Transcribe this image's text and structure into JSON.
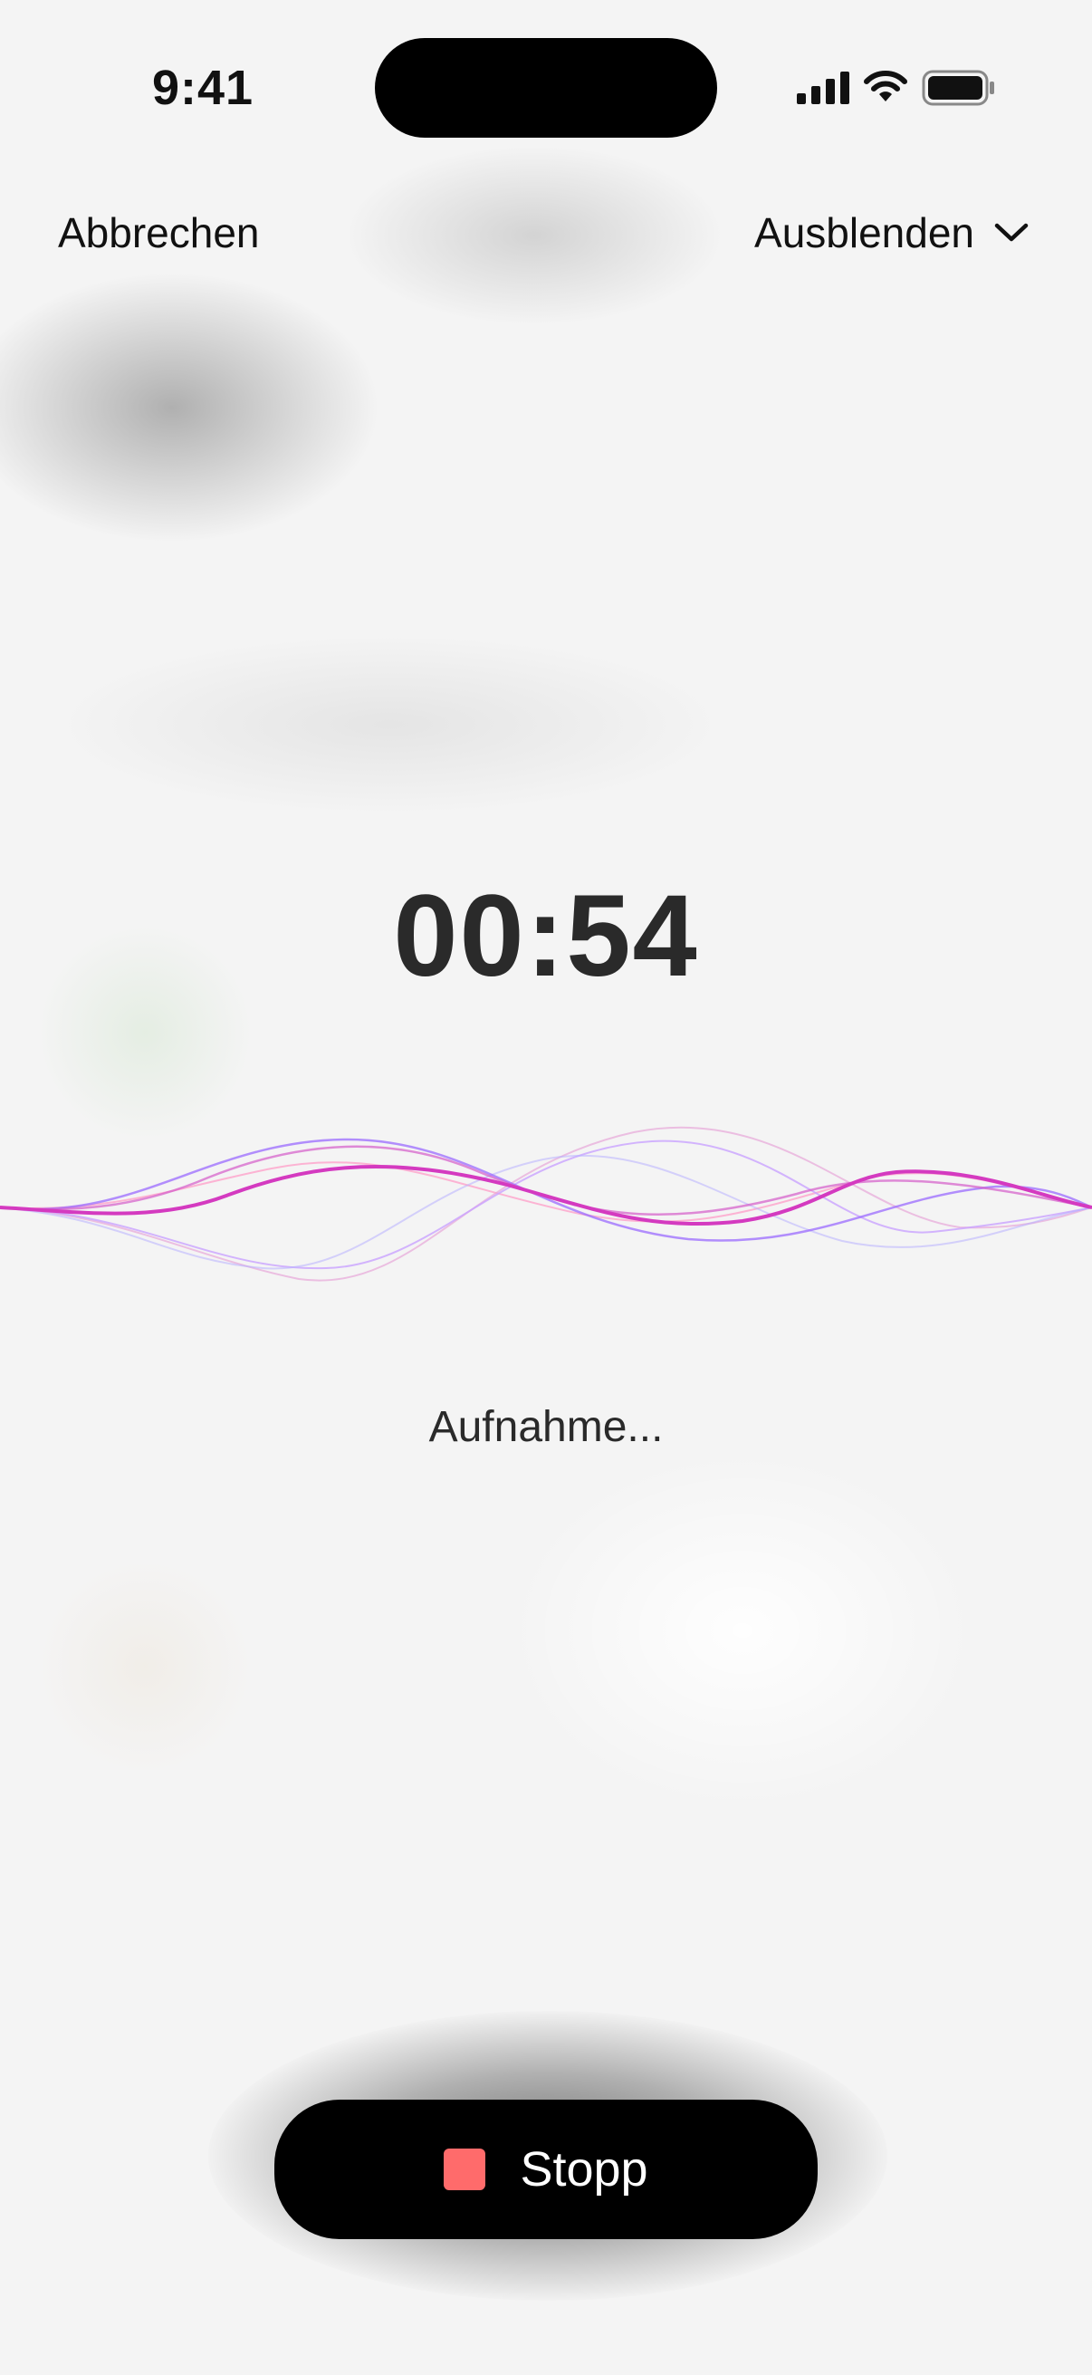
{
  "status_bar": {
    "time": "9:41",
    "icons": [
      "cellular-signal-icon",
      "wifi-icon",
      "battery-icon"
    ]
  },
  "nav": {
    "cancel_label": "Abbrechen",
    "hide_label": "Ausblenden",
    "hide_icon": "chevron-down-icon"
  },
  "recorder": {
    "elapsed": "00:54",
    "status": "Aufnahme...",
    "stop_label": "Stopp",
    "stop_icon": "stop-square-icon"
  },
  "colors": {
    "background": "#f4f4f4",
    "wave_primary": "#d43ac0",
    "wave_secondary": "#9b6bff",
    "stop_accent": "#ff6b6b",
    "button_bg": "#000000"
  }
}
